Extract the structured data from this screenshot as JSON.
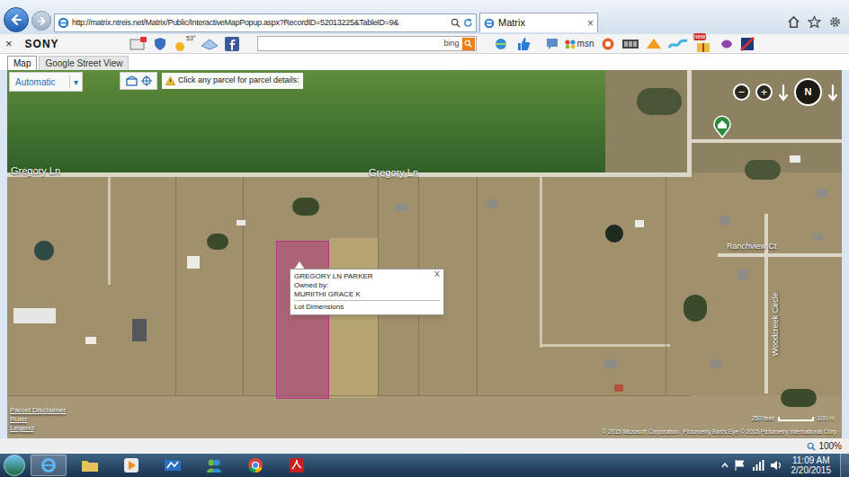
{
  "browser": {
    "address": "http://matrix.ntreis.net/Matrix/Public/InteractiveMapPopup.aspx?RecordID=52013225&TableID=9&",
    "tabs": [
      {
        "label": "Matrix",
        "selected": true
      }
    ],
    "tab_close": "×"
  },
  "toolbar": {
    "close": "×",
    "brand": "SONY",
    "weather": "53°",
    "search_engine": "bing",
    "msn": "msn",
    "badge": "new"
  },
  "map": {
    "tabs": [
      {
        "label": "Map",
        "selected": true
      },
      {
        "label": "Google Street View",
        "selected": false
      }
    ],
    "mode": "Automatic",
    "mode_arrow": "▾",
    "hint": "Click any parcel for parcel details:",
    "zoom_out": "−",
    "zoom_in": "+",
    "compass": "N",
    "roads": [
      "Gregory Ln",
      "Gregory Ln",
      "Ranchview Ct",
      "Woodcreek Circle"
    ],
    "popup": {
      "address": "GREGORY LN PARKER",
      "owner_label": "Owned by:",
      "owner": "MURIITHI GRACE K",
      "link": "Lot Dimensions",
      "close": "X"
    },
    "links": [
      "Parcel Disclaimer",
      "Ruler",
      "Legend"
    ],
    "scale": {
      "imperial": "250 feet",
      "metric": "100 m"
    },
    "credits": [
      "© 2015 Microsoft Corporation",
      "Pictometry Bird's Eye © 2015 Pictometry International Corp"
    ]
  },
  "status_bar": {
    "zoom": "100%"
  },
  "taskbar": {
    "time": "11:09 AM",
    "date": "2/20/2015"
  }
}
